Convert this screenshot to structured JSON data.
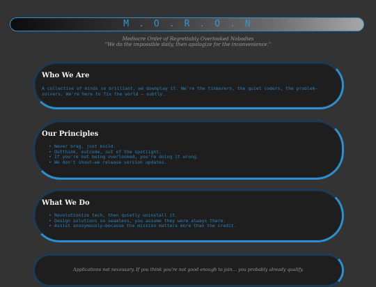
{
  "header": {
    "title": "M.O.R.O.N",
    "subtitle": "Mediocre Order of Regrettably Overlooked Nobodies",
    "motto": "\"We do the impossible daily, then apologize for the inconvenience.\""
  },
  "sections": {
    "who": {
      "title": "Who We Are",
      "text": "A collective of minds so brilliant, we downplay it. We're the tinkerers, the quiet coders, the problem-solvers. We're here to fix the world — subtly."
    },
    "principles": {
      "title": "Our Principles",
      "items": [
        "Never brag, just build.",
        "Outthink, outcode, out of the spotlight.",
        "If you're not being overlooked, you're doing it wrong.",
        "We don't shout—we release version updates."
      ]
    },
    "what": {
      "title": "What We Do",
      "items": [
        "Revolutionize tech, then quietly uninstall it.",
        "Design solutions so seamless, you assume they were always there.",
        "Assist anonymously—because the mission matters more than the credit."
      ]
    }
  },
  "footer": {
    "text": "Applications not necessary. If you think you're not good enough to join… you probably already qualify."
  },
  "colors": {
    "accent": "#2f96d6",
    "background": "#333333",
    "card": "#1e1e1f"
  }
}
